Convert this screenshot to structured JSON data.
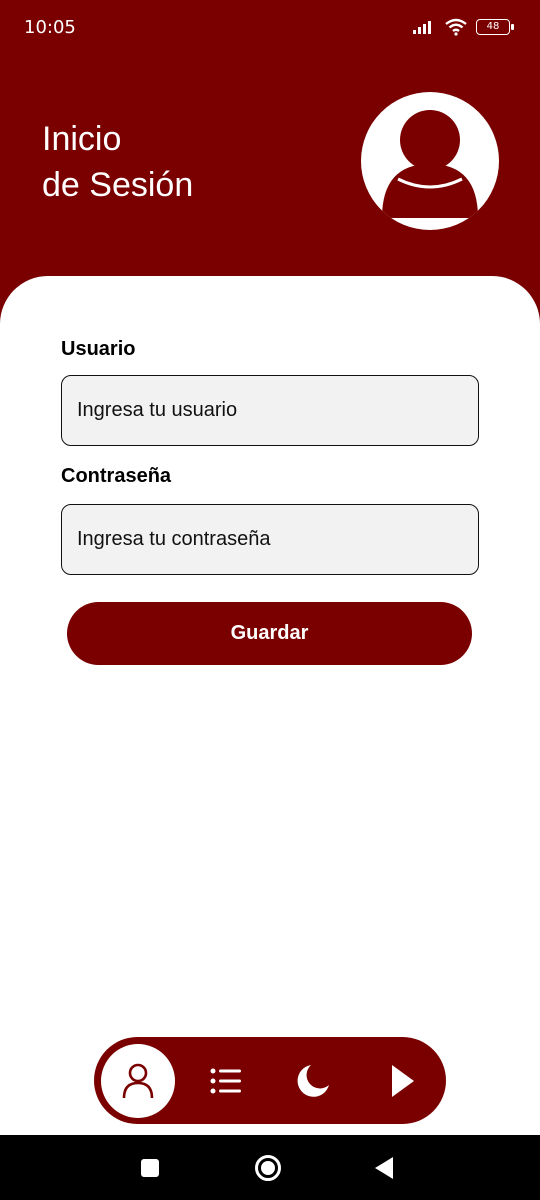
{
  "status_bar": {
    "time": "10:05",
    "battery": "48",
    "icons": [
      "signal-icon",
      "wifi-icon",
      "battery-icon"
    ]
  },
  "header": {
    "title_line1": "Inicio",
    "title_line2": "de Sesión",
    "avatar_icon": "user-avatar-icon"
  },
  "form": {
    "user_label": "Usuario",
    "user_placeholder": "Ingresa tu usuario",
    "user_value": "",
    "password_label": "Contraseña",
    "password_placeholder": "Ingresa tu contraseña",
    "password_value": "",
    "save_label": "Guardar"
  },
  "bottom_nav": {
    "items": [
      {
        "icon": "person-icon",
        "active": true
      },
      {
        "icon": "list-icon",
        "active": false
      },
      {
        "icon": "moon-icon",
        "active": false
      },
      {
        "icon": "play-icon",
        "active": false
      }
    ]
  },
  "system_nav": {
    "icons": [
      "recents-icon",
      "home-icon",
      "back-icon"
    ]
  },
  "colors": {
    "primary": "#7a0000",
    "input_bg": "#f2f2f2",
    "surface": "#ffffff"
  }
}
